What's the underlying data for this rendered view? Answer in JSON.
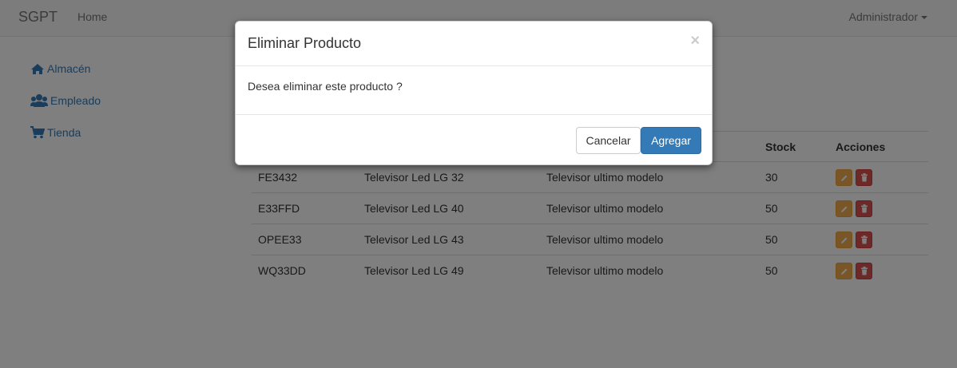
{
  "navbar": {
    "brand": "SGPT",
    "home": "Home",
    "user": "Administrador"
  },
  "sidebar": {
    "items": [
      {
        "label": "Almacén",
        "icon": "home-icon"
      },
      {
        "label": "Empleado",
        "icon": "users-icon"
      },
      {
        "label": "Tienda",
        "icon": "shopping-cart-icon"
      }
    ]
  },
  "table": {
    "headers": {
      "stock": "Stock",
      "actions": "Acciones"
    },
    "rows": [
      {
        "code": "FE3432",
        "name": "Televisor Led LG 32",
        "description": "Televisor ultimo modelo",
        "stock": "30"
      },
      {
        "code": "E33FFD",
        "name": "Televisor Led LG 40",
        "description": "Televisor ultimo modelo",
        "stock": "50"
      },
      {
        "code": "OPEE33",
        "name": "Televisor Led LG 43",
        "description": "Televisor ultimo modelo",
        "stock": "50"
      },
      {
        "code": "WQ33DD",
        "name": "Televisor Led LG 49",
        "description": "Televisor ultimo modelo",
        "stock": "50"
      }
    ]
  },
  "modal": {
    "title": "Eliminar Producto",
    "close": "×",
    "body": "Desea eliminar este producto ?",
    "cancel_label": "Cancelar",
    "confirm_label": "Agregar"
  },
  "colors": {
    "primary": "#337ab7",
    "warning": "#f0ad4e",
    "danger": "#d9534f"
  }
}
